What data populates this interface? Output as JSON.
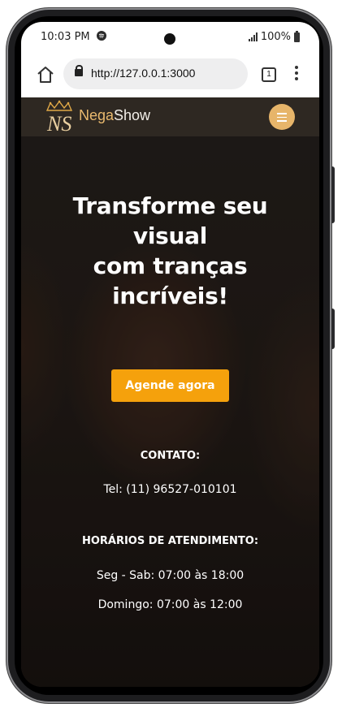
{
  "status_bar": {
    "time": "10:03 PM",
    "battery": "100%"
  },
  "browser": {
    "url": "http://127.0.0.1:3000",
    "tab_count": "1"
  },
  "site": {
    "brand_part1": "Nega",
    "brand_part2": "Show",
    "logo_initials": "NS"
  },
  "hero": {
    "headline_lines": [
      "Transforme seu",
      "visual",
      "com tranças",
      "incríveis!"
    ],
    "cta_label": "Agende agora"
  },
  "contact": {
    "heading": "CONTATO:",
    "phone": "Tel: (11) 96527-010101"
  },
  "hours": {
    "heading": "HORÁRIOS DE ATENDIMENTO:",
    "weekdays": "Seg - Sab: 07:00 às 18:00",
    "sunday": "Domingo: 07:00 às 12:00"
  },
  "colors": {
    "accent_orange": "#f5a10c",
    "brand_gold": "#e9b96e",
    "nav_bg": "#2e2822"
  },
  "icons": [
    "spotify-icon",
    "signal-icon",
    "battery-icon",
    "home-icon",
    "lock-icon",
    "tabs-icon",
    "more-icon",
    "menu-icon",
    "crown-icon"
  ]
}
